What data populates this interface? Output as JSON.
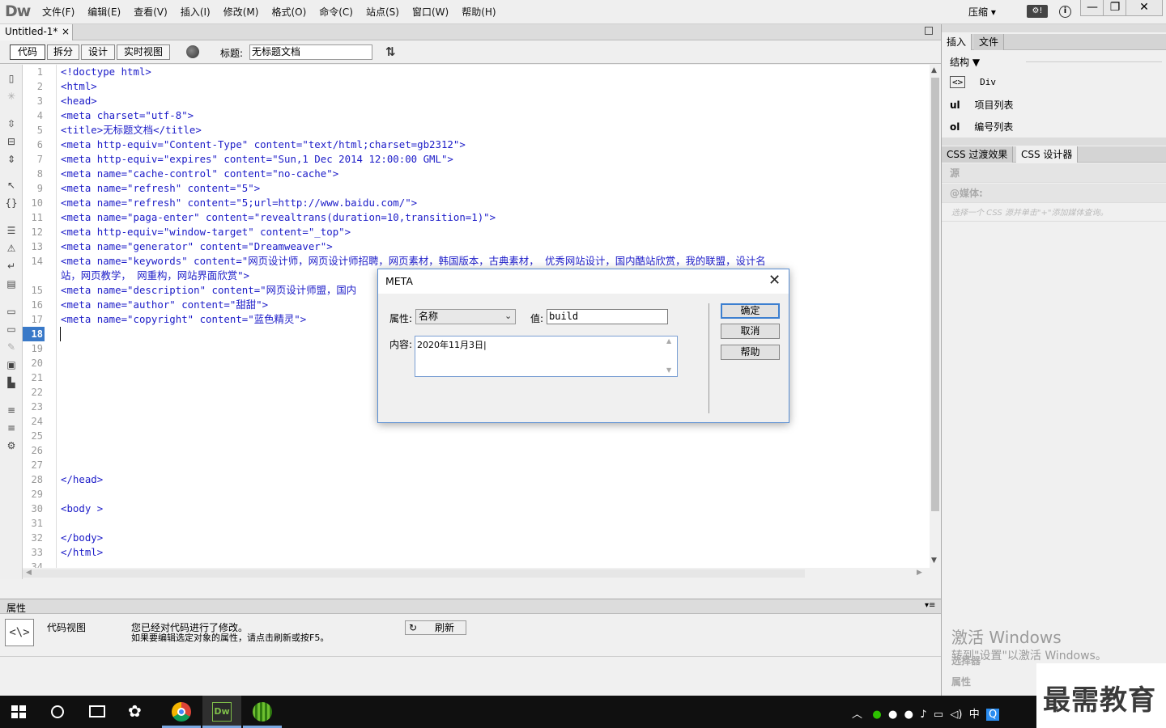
{
  "app": {
    "logo": "Dw",
    "menu": [
      "文件(F)",
      "编辑(E)",
      "查看(V)",
      "插入(I)",
      "修改(M)",
      "格式(O)",
      "命令(C)",
      "站点(S)",
      "窗口(W)",
      "帮助(H)"
    ],
    "compress": "压缩 ▾",
    "window_controls": [
      "—",
      "❐",
      "✕"
    ]
  },
  "document": {
    "tab_name": "Untitled-1*",
    "tab_close": "×",
    "views": [
      "代码",
      "拆分",
      "设计",
      "实时视图"
    ],
    "title_label": "标题:",
    "title_value": "无标题文档"
  },
  "code": {
    "line_numbers": [
      "1",
      "2",
      "3",
      "4",
      "5",
      "6",
      "7",
      "8",
      "9",
      "10",
      "11",
      "12",
      "13",
      "14",
      "",
      "15",
      "16",
      "17",
      "18",
      "19",
      "20",
      "21",
      "22",
      "23",
      "24",
      "25",
      "26",
      "27",
      "28",
      "29",
      "30",
      "31",
      "32",
      "33",
      "34"
    ],
    "current_line": "18",
    "lines": [
      "<!doctype html>",
      "<html>",
      "<head>",
      "<meta charset=\"utf-8\">",
      "<title>无标题文档</title>",
      "<meta http-equiv=\"Content-Type\" content=\"text/html;charset=gb2312\">",
      "<meta http-equiv=\"expires\" content=\"Sun,1 Dec 2014 12:00:00 GML\">",
      "<meta name=\"cache-control\" content=\"no-cache\">",
      "<meta name=\"refresh\" content=\"5\">",
      "<meta name=\"refresh\" content=\"5;url=http://www.baidu.com/\">",
      "<meta name=\"paga-enter\" content=\"revealtrans(duration=10,transition=1)\">",
      "<meta http-equiv=\"window-target\" content=\"_top\">",
      "<meta name=\"generator\" content=\"Dreamweaver\">",
      "<meta name=\"keywords\" content=\"网页设计师，网页设计师招聘，网页素材，韩国版本，古典素材， 优秀网站设计，国内酷站欣赏，我的联盟，设计名",
      "站，网页教学， 网重构，网站界面欣赏\">",
      "<meta name=\"description\" content=\"网页设计师盟，国内",
      "<meta name=\"author\" content=\"甜甜\">",
      "<meta name=\"copyright\" content=\"蓝色精灵\">",
      "",
      "",
      "",
      "",
      "",
      "",
      "",
      "",
      "",
      "",
      "</head>",
      "",
      "<body >",
      "",
      "</body>",
      "</html>"
    ]
  },
  "properties": {
    "title": "属性",
    "view_label": "代码视图",
    "icon": "<\\>",
    "message_line1": "您已经对代码进行了修改。",
    "message_line2": "如果要编辑选定对象的属性，请点击刷新或按F5。",
    "refresh": "刷新"
  },
  "right_panel": {
    "tabs_top": [
      "插入",
      "文件"
    ],
    "category": "结构",
    "insert_items": [
      {
        "icon": "<>",
        "label": "Div"
      },
      {
        "icon": "ul",
        "label": "项目列表"
      },
      {
        "icon": "ol",
        "label": "编号列表"
      }
    ],
    "tabs_css": [
      "CSS 过渡效果",
      "CSS 设计器"
    ],
    "source_label": "源",
    "media_label": "@媒体:",
    "media_hint": "选择一个 CSS 源并单击\"+\"添加媒体查询。",
    "selector_label": "选择器",
    "attr_label": "属性",
    "activate_title": "激活 Windows",
    "activate_sub": "转到\"设置\"以激活 Windows。"
  },
  "dialog": {
    "title": "META",
    "close": "✕",
    "attr_label": "属性:",
    "attr_value": "名称",
    "value_label": "值:",
    "value_value": "build",
    "content_label": "内容:",
    "content_value": "2020年11月3日|",
    "buttons": [
      "确定",
      "取消",
      "帮助"
    ]
  },
  "taskbar": {
    "tray_text": "中",
    "watermark": "最需教育"
  }
}
